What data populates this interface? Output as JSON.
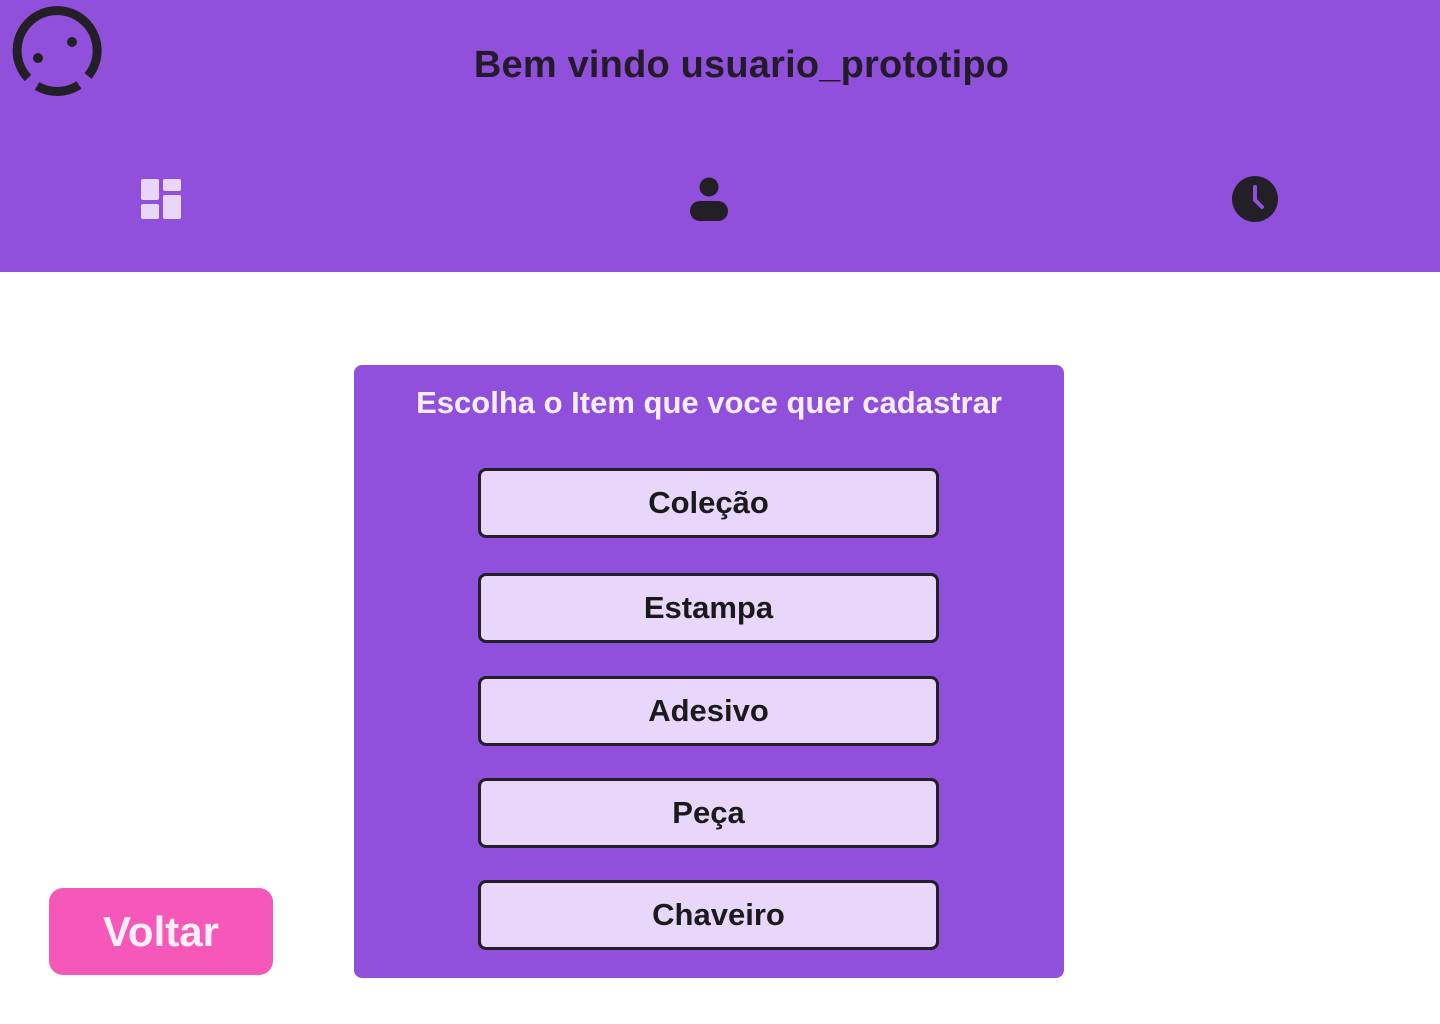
{
  "header": {
    "welcome_text": "Bem vindo usuario_prototipo",
    "logo_icon": "smiley-face-icon",
    "nav": [
      {
        "icon": "dashboard-icon",
        "color": "#E8D7FA"
      },
      {
        "icon": "user-icon",
        "color": "#231F26"
      },
      {
        "icon": "clock-icon",
        "color": "#231F26"
      }
    ]
  },
  "panel": {
    "title": "Escolha o Item que voce quer cadastrar",
    "items": [
      {
        "label": "Coleção"
      },
      {
        "label": "Estampa"
      },
      {
        "label": "Adesivo"
      },
      {
        "label": "Peça"
      },
      {
        "label": "Chaveiro"
      }
    ]
  },
  "back_button": {
    "label": "Voltar"
  },
  "colors": {
    "brand_purple": "#9150DC",
    "item_bg": "#E8D7FA",
    "back_pink": "#F558B8",
    "dark": "#231F26"
  }
}
